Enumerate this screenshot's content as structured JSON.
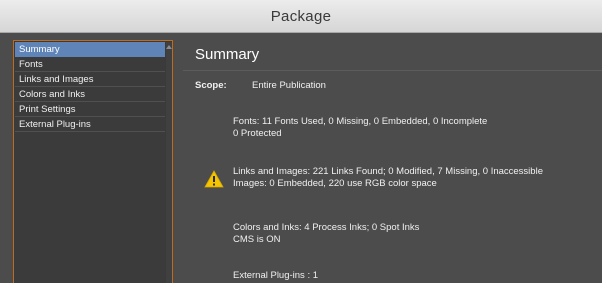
{
  "window": {
    "title": "Package"
  },
  "sidebar": {
    "items": [
      {
        "label": "Summary",
        "selected": true
      },
      {
        "label": "Fonts",
        "selected": false
      },
      {
        "label": "Links and Images",
        "selected": false
      },
      {
        "label": "Colors and Inks",
        "selected": false
      },
      {
        "label": "Print Settings",
        "selected": false
      },
      {
        "label": "External Plug-ins",
        "selected": false
      }
    ]
  },
  "summary": {
    "heading": "Summary",
    "scope_label": "Scope:",
    "scope_value": "Entire Publication",
    "fonts": {
      "line1": "Fonts: 11 Fonts Used, 0 Missing, 0 Embedded, 0 Incomplete",
      "line2": "0 Protected"
    },
    "links": {
      "line1": "Links and Images: 221 Links Found; 0 Modified, 7 Missing, 0 Inaccessible",
      "line2": "Images: 0 Embedded, 220 use RGB color space",
      "warning_icon": "warning-triangle-icon"
    },
    "colors": {
      "line1": "Colors and Inks: 4 Process Inks; 0 Spot Inks",
      "line2": "CMS is ON"
    },
    "plugins": {
      "line1": "External Plug-ins : 1"
    }
  },
  "colors": {
    "selection": "#5f85b8",
    "frame_accent": "#c06a1c",
    "warning": "#f5c400"
  }
}
